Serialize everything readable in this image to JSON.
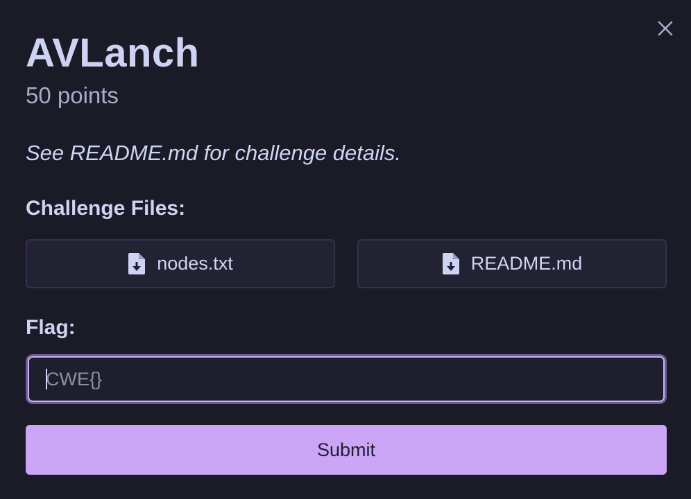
{
  "challenge": {
    "title": "AVLanch",
    "points": "50 points",
    "description": "See README.md for challenge details."
  },
  "files": {
    "heading": "Challenge Files:",
    "items": [
      {
        "label": "nodes.txt",
        "icon": "file-download-icon"
      },
      {
        "label": "README.md",
        "icon": "file-download-icon"
      }
    ]
  },
  "flag": {
    "heading": "Flag:",
    "value": "",
    "placeholder": "CWE{}"
  },
  "submit": {
    "label": "Submit"
  },
  "close": {
    "icon": "close-icon"
  },
  "colors": {
    "background": "#1b1a27",
    "accent": "#cba6f7",
    "text": "#cdd6f4",
    "muted": "#a6adc8"
  }
}
